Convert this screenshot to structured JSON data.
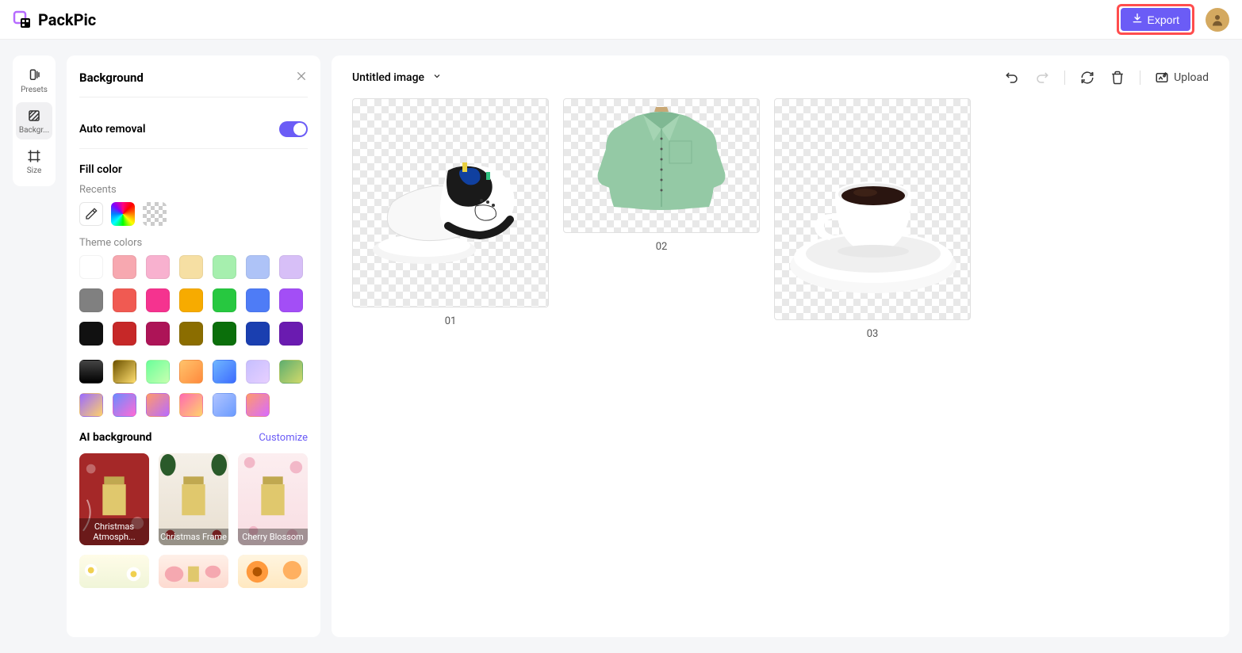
{
  "brand": "PackPic",
  "header": {
    "export_label": "Export"
  },
  "tools": [
    {
      "id": "presets",
      "label": "Presets"
    },
    {
      "id": "background",
      "label": "Backgr..."
    },
    {
      "id": "size",
      "label": "Size"
    }
  ],
  "panel": {
    "title": "Background",
    "auto_removal": "Auto removal",
    "fill_color": "Fill color",
    "recents": "Recents",
    "theme_colors": "Theme colors",
    "ai_background": "AI background",
    "customize": "Customize"
  },
  "theme_colors": [
    "#ffffff",
    "#f7a8b0",
    "#f8b1cf",
    "#f6dfa3",
    "#a6efae",
    "#aec3f7",
    "#d7bff7",
    "#808080",
    "#f05a52",
    "#f5338f",
    "#f7ab00",
    "#27c840",
    "#4e7cf6",
    "#a34ef6",
    "#111111",
    "#c62828",
    "#ad1457",
    "#8b6d00",
    "#0b6f0b",
    "#1a3fb0",
    "#6a1bb0"
  ],
  "theme_gradients": [
    "linear-gradient(180deg,#444,#000)",
    "linear-gradient(135deg,#6d5200,#ffdf70)",
    "linear-gradient(135deg,#6aff9a,#c8ffb0)",
    "linear-gradient(135deg,#ffc36b,#ff8a3d)",
    "linear-gradient(135deg,#6fb6ff,#3d6cff)",
    "linear-gradient(135deg,#c6bfff,#e7cfff)",
    "",
    "linear-gradient(135deg,#5fae6f,#d0d96a)",
    "linear-gradient(135deg,#9b6bff,#ffd16b)",
    "linear-gradient(135deg,#6b8bff,#ff6bd6)",
    "linear-gradient(135deg,#ff9a6b,#b86bff)",
    "linear-gradient(135deg,#ff6bb0,#ffd26b)",
    "linear-gradient(135deg,#b0c4ff,#6b9bff)",
    "linear-gradient(135deg,#ff9a6b,#d86bff)"
  ],
  "ai_backgrounds": [
    {
      "label": "Christmas Atmosph..."
    },
    {
      "label": "Christmas Frame"
    },
    {
      "label": "Cherry Blossom"
    }
  ],
  "canvas": {
    "image_name": "Untitled image",
    "upload": "Upload",
    "items": [
      {
        "num": "01"
      },
      {
        "num": "02"
      },
      {
        "num": "03"
      }
    ]
  }
}
